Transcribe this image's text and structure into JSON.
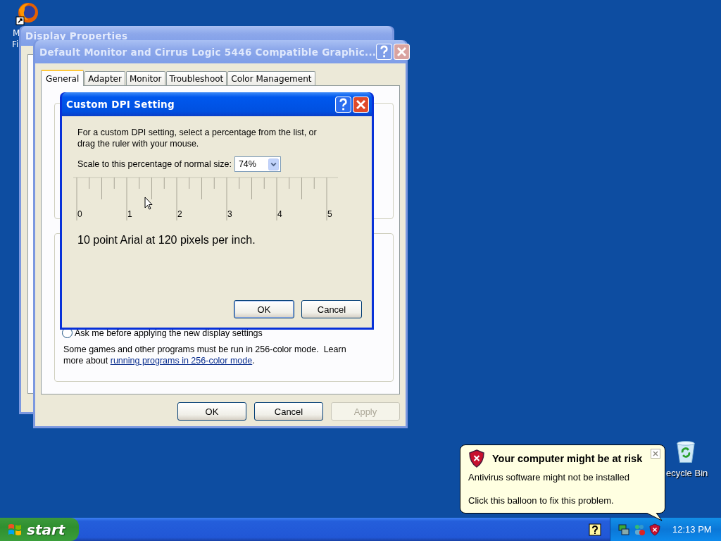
{
  "desktop": {
    "shortcut_label_lines": [
      "M",
      "Fi"
    ],
    "trash_label": "ecycle Bin"
  },
  "back_window": {
    "title": "Display Properties"
  },
  "window": {
    "title": "Default Monitor and Cirrus Logic 5446 Compatible Graphic...",
    "tabs": [
      {
        "label": "General",
        "selected": true
      },
      {
        "label": "Adapter",
        "selected": false
      },
      {
        "label": "Monitor",
        "selected": false
      },
      {
        "label": "Troubleshoot",
        "selected": false
      },
      {
        "label": "Color Management",
        "selected": false
      }
    ],
    "radio": {
      "label": "Ask me before applying the new display settings",
      "selected": false
    },
    "note": {
      "text": "Some games and other programs must be run in 256-color mode.  Learn more about ",
      "link": "running programs in 256-color mode",
      "after": "."
    },
    "buttons": [
      {
        "label": "OK",
        "disabled": false
      },
      {
        "label": "Cancel",
        "disabled": false
      },
      {
        "label": "Apply",
        "disabled": true
      }
    ]
  },
  "dialog": {
    "title": "Custom DPI Setting",
    "instructions": "For a custom DPI setting, select a percentage from the list, or drag the ruler with your mouse.",
    "scale_label": "Scale to this percentage of normal size:",
    "scale_value": "74%",
    "ruler_labels": [
      "0",
      "1",
      "2",
      "3",
      "4",
      "5"
    ],
    "sample": "10 point Arial at 120 pixels per inch.",
    "buttons": [
      "OK",
      "Cancel"
    ]
  },
  "balloon": {
    "title": "Your computer might be at risk",
    "lines": [
      "Antivirus software might not be installed",
      "Click this balloon to fix this problem."
    ]
  },
  "taskbar": {
    "start": "start",
    "clock": "12:13 PM"
  }
}
